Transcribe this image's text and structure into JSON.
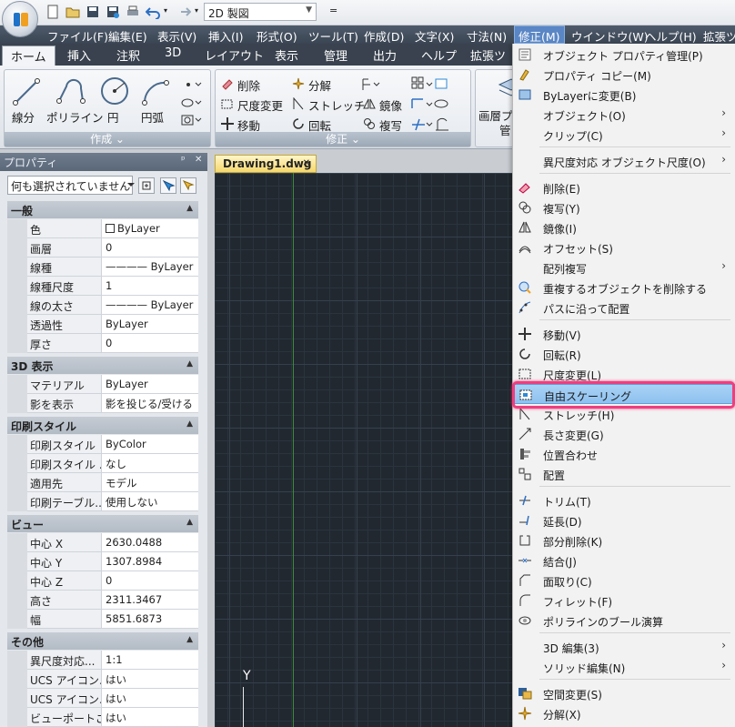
{
  "quick_access": {
    "workspace": "2D 製図",
    "overflow": "="
  },
  "menubar": [
    {
      "label": "ファイル(F)"
    },
    {
      "label": "編集(E)"
    },
    {
      "label": "表示(V)"
    },
    {
      "label": "挿入(I)"
    },
    {
      "label": "形式(O)"
    },
    {
      "label": "ツール(T)"
    },
    {
      "label": "作成(D)"
    },
    {
      "label": "文字(X)"
    },
    {
      "label": "寸法(N)"
    },
    {
      "label": "修正(M)"
    },
    {
      "label": "ウインドウ(W)"
    },
    {
      "label": "ヘルプ(H)"
    },
    {
      "label": "拡張ツ"
    }
  ],
  "ribbon_tabs": [
    {
      "label": "ホーム"
    },
    {
      "label": "挿入"
    },
    {
      "label": "注釈"
    },
    {
      "label": "3D"
    },
    {
      "label": "レイアウト"
    },
    {
      "label": "表示"
    },
    {
      "label": "管理"
    },
    {
      "label": "出力"
    },
    {
      "label": "ヘルプ"
    },
    {
      "label": "拡張ツ"
    }
  ],
  "ribbon": {
    "create_panel": {
      "title": "作成 ⌄",
      "tools": [
        {
          "label": "線分",
          "icon": "line-icon"
        },
        {
          "label": "ポリライン",
          "icon": "polyline-icon"
        },
        {
          "label": "円",
          "icon": "circle-icon"
        },
        {
          "label": "円弧",
          "icon": "arc-icon"
        }
      ]
    },
    "modify_panel": {
      "title": "修正 ⌄",
      "tools": [
        {
          "label": "削除",
          "icon": "erase-icon"
        },
        {
          "label": "分解",
          "icon": "explode-icon"
        },
        {
          "label": "尺度変更",
          "icon": "scale-icon"
        },
        {
          "label": "ストレッチ",
          "icon": "stretch-icon"
        },
        {
          "label": "鏡像",
          "icon": "mirror-icon"
        },
        {
          "label": "移動",
          "icon": "move-icon"
        },
        {
          "label": "回転",
          "icon": "rotate-icon"
        },
        {
          "label": "複写",
          "icon": "copy-icon"
        }
      ]
    },
    "layer_panel": {
      "label_line1": "画層プ",
      "label_line2": "管"
    }
  },
  "properties": {
    "title": "プロパティ",
    "pin": "ᵖ",
    "close": "✕",
    "selection": "何も選択されていません",
    "sections": [
      {
        "title": "一般",
        "rows": [
          {
            "key": "色",
            "value": "ByLayer"
          },
          {
            "key": "画層",
            "value": "0"
          },
          {
            "key": "線種",
            "value": "———— ByLayer"
          },
          {
            "key": "線種尺度",
            "value": "1"
          },
          {
            "key": "線の太さ",
            "value": "———— ByLayer"
          },
          {
            "key": "透過性",
            "value": "ByLayer"
          },
          {
            "key": "厚さ",
            "value": "0"
          }
        ]
      },
      {
        "title": "3D 表示",
        "rows": [
          {
            "key": "マテリアル",
            "value": "ByLayer"
          },
          {
            "key": "影を表示",
            "value": "影を投じる/受ける"
          }
        ]
      },
      {
        "title": "印刷スタイル",
        "rows": [
          {
            "key": "印刷スタイル",
            "value": "ByColor"
          },
          {
            "key": "印刷スタイル ...",
            "value": "なし"
          },
          {
            "key": "適用先",
            "value": "モデル"
          },
          {
            "key": "印刷テーブル...",
            "value": "使用しない"
          }
        ]
      },
      {
        "title": "ビュー",
        "rows": [
          {
            "key": "中心 X",
            "value": "2630.0488"
          },
          {
            "key": "中心 Y",
            "value": "1307.8984"
          },
          {
            "key": "中心 Z",
            "value": "0"
          },
          {
            "key": "高さ",
            "value": "2311.3467"
          },
          {
            "key": "幅",
            "value": "5851.6873"
          }
        ]
      },
      {
        "title": "その他",
        "rows": [
          {
            "key": "異尺度対応...",
            "value": "1:1"
          },
          {
            "key": "UCS アイコン...",
            "value": "はい"
          },
          {
            "key": "UCS アイコン...",
            "value": "はい"
          },
          {
            "key": "ビューポートご...",
            "value": "はい"
          }
        ]
      }
    ]
  },
  "document": {
    "tab": "Drawing1.dwg",
    "tab_close": "✕",
    "ucs_label": "Y"
  },
  "modify_menu": {
    "items": [
      {
        "label": "オブジェクト プロパティ管理(P)",
        "icon": "properties-icon"
      },
      {
        "label": "プロパティ コピー(M)",
        "icon": "match-properties-icon"
      },
      {
        "label": "ByLayerに変更(B)",
        "icon": "bylayer-icon"
      },
      {
        "label": "オブジェクト(O)",
        "icon": "",
        "submenu": "›"
      },
      {
        "label": "クリップ(C)",
        "icon": "",
        "submenu": "›"
      },
      {
        "sep": true
      },
      {
        "label": "異尺度対応 オブジェクト尺度(O)",
        "icon": "",
        "submenu": "›"
      },
      {
        "sep": true
      },
      {
        "label": "削除(E)",
        "icon": "erase-icon"
      },
      {
        "label": "複写(Y)",
        "icon": "copy-icon"
      },
      {
        "label": "鏡像(I)",
        "icon": "mirror-icon"
      },
      {
        "label": "オフセット(S)",
        "icon": "offset-icon"
      },
      {
        "label": "配列複写",
        "icon": "",
        "submenu": "›"
      },
      {
        "label": "重複するオブジェクトを削除する",
        "icon": "overkill-icon"
      },
      {
        "label": "パスに沿って配置",
        "icon": "path-array-icon"
      },
      {
        "sep": true
      },
      {
        "label": "移動(V)",
        "icon": "move-icon"
      },
      {
        "label": "回転(R)",
        "icon": "rotate-icon"
      },
      {
        "label": "尺度変更(L)",
        "icon": "scale-icon"
      },
      {
        "label": "自由スケーリング",
        "icon": "free-scale-icon",
        "highlighted": true
      },
      {
        "label": "ストレッチ(H)",
        "icon": "stretch-icon"
      },
      {
        "label": "長さ変更(G)",
        "icon": "lengthen-icon"
      },
      {
        "label": "位置合わせ",
        "icon": "align-icon"
      },
      {
        "label": "配置",
        "icon": "arrange-icon"
      },
      {
        "sep": true
      },
      {
        "label": "トリム(T)",
        "icon": "trim-icon"
      },
      {
        "label": "延長(D)",
        "icon": "extend-icon"
      },
      {
        "label": "部分削除(K)",
        "icon": "break-icon"
      },
      {
        "label": "結合(J)",
        "icon": "join-icon"
      },
      {
        "label": "面取り(C)",
        "icon": "chamfer-icon"
      },
      {
        "label": "フィレット(F)",
        "icon": "fillet-icon"
      },
      {
        "label": "ポリラインのブール演算",
        "icon": "polyline-boolean-icon"
      },
      {
        "sep": true
      },
      {
        "label": "3D 編集(3)",
        "icon": "",
        "submenu": "›"
      },
      {
        "label": "ソリッド編集(N)",
        "icon": "",
        "submenu": "›"
      },
      {
        "sep": true
      },
      {
        "label": "空間変更(S)",
        "icon": "change-space-icon"
      },
      {
        "label": "分解(X)",
        "icon": "explode-icon"
      }
    ]
  },
  "colors": {
    "menubar": "#3b4553",
    "canvas": "#212830",
    "highlight": "#8ec1ef",
    "highlight_ring": "#ef3e7e",
    "doc_tab": "#f5d76e"
  }
}
